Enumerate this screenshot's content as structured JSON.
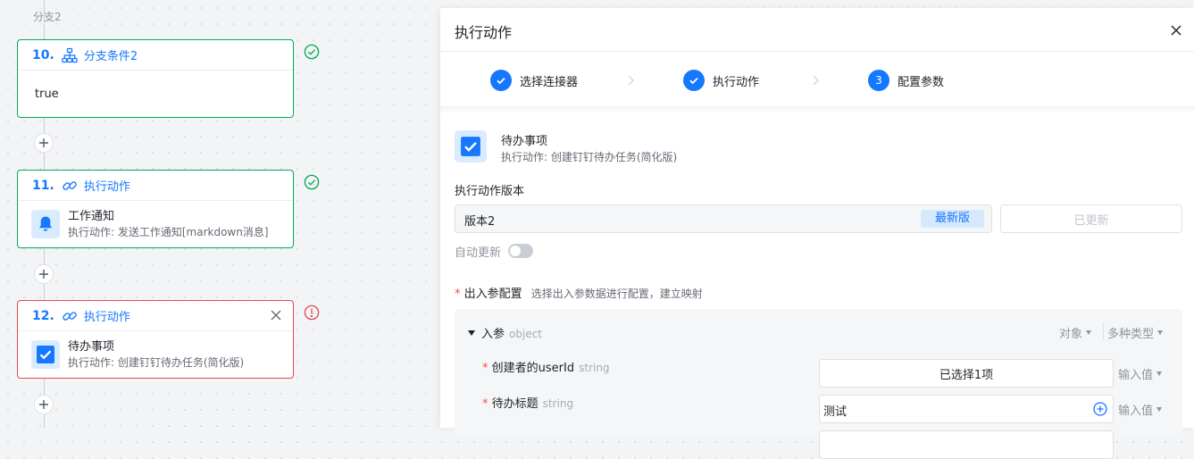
{
  "left": {
    "branch_label": "分支2",
    "cards": [
      {
        "num": "10.",
        "title": "分支条件2",
        "body": "true"
      },
      {
        "num": "11.",
        "title": "执行动作",
        "action_title": "工作通知",
        "action_sub": "执行动作: 发送工作通知[markdown消息]"
      },
      {
        "num": "12.",
        "title": "执行动作",
        "action_title": "待办事项",
        "action_sub": "执行动作: 创建钉钉待办任务(简化版)"
      }
    ]
  },
  "panel": {
    "title": "执行动作",
    "steps": [
      {
        "label": "选择连接器"
      },
      {
        "label": "执行动作"
      },
      {
        "number": "3",
        "label": "配置参数"
      }
    ],
    "header": {
      "title": "待办事项",
      "subtitle": "执行动作: 创建钉钉待办任务(简化版)"
    },
    "version": {
      "label": "执行动作版本",
      "value": "版本2",
      "latest_tag": "最新版",
      "updated_button": "已更新",
      "auto_update_label": "自动更新"
    },
    "io": {
      "required_mark": "*",
      "label": "出入参配置",
      "hint": "选择出入参数据进行配置，建立映射"
    },
    "params": {
      "root": {
        "name": "入参",
        "type": "object",
        "select1": "对象",
        "select2": "多种类型"
      },
      "rows": [
        {
          "required_mark": "*",
          "name": "创建者的userId",
          "type": "string",
          "value": "已选择1项",
          "mode": "输入值"
        },
        {
          "required_mark": "*",
          "name": "待办标题",
          "type": "string",
          "value": "测试",
          "mode": "输入值"
        }
      ]
    }
  },
  "colors": {
    "primary": "#1677ff",
    "success": "#00a854",
    "error": "#e5484d"
  }
}
